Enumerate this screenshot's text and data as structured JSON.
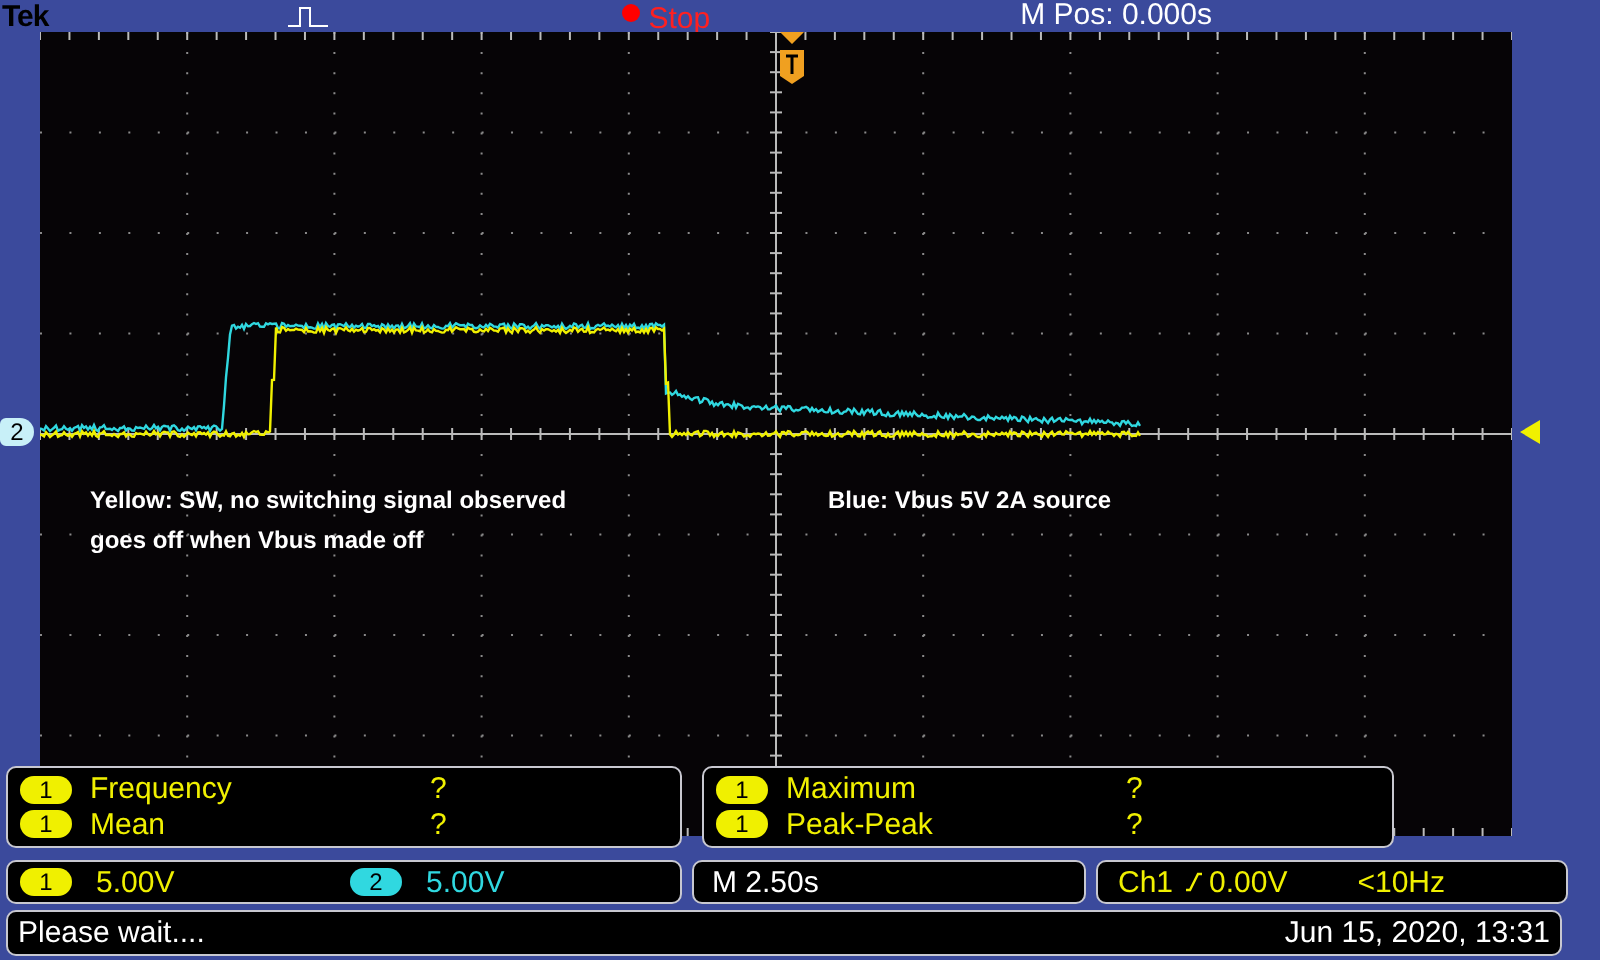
{
  "header": {
    "brand": "Tek",
    "run_state": {
      "label": "Stop",
      "running": false
    },
    "position": "M Pos: 0.000s"
  },
  "screen": {
    "channel_marker": "2",
    "annotations": [
      {
        "text": "Yellow: SW, no switching signal observed\ngoes off when Vbus made off"
      },
      {
        "text": "Blue: Vbus 5V 2A source"
      }
    ]
  },
  "measurement_panels": [
    {
      "rows": [
        {
          "channel": "1",
          "name": "Frequency",
          "value": "?"
        },
        {
          "channel": "1",
          "name": "Mean",
          "value": "?"
        }
      ]
    },
    {
      "rows": [
        {
          "channel": "1",
          "name": "Maximum",
          "value": "?"
        },
        {
          "channel": "1",
          "name": "Peak-Peak",
          "value": "?"
        }
      ]
    }
  ],
  "settings": {
    "channels": [
      {
        "label": "1",
        "scale": "5.00V",
        "color": "#f0f000"
      },
      {
        "label": "2",
        "scale": "5.00V",
        "color": "#30d8e0"
      }
    ],
    "timebase": "M 2.50s",
    "trigger": {
      "source": "Ch1",
      "level": "0.00V",
      "frequency": "<10Hz"
    }
  },
  "status": {
    "message": "Please wait....",
    "datetime": "Jun 15, 2020, 13:31"
  }
}
